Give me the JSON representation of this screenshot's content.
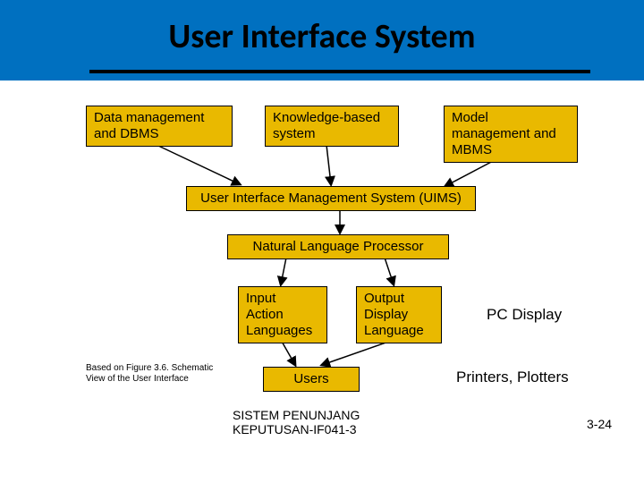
{
  "title": "User Interface System",
  "boxes": {
    "data_mgmt": "Data management and DBMS",
    "knowledge": "Knowledge-based system",
    "model_mgmt": "Model management and MBMS",
    "uims": "User Interface Management System (UIMS)",
    "nlp": "Natural Language Processor",
    "input_l1": "Input",
    "input_l2": "Action Languages",
    "output_l1": "Output",
    "output_l2": "Display Language",
    "users": "Users"
  },
  "labels": {
    "pc_display": "PC Display",
    "printers": "Printers, Plotters"
  },
  "caption": "Based on Figure 3.6. Schematic View of the User Interface",
  "footer": "SISTEM PENUNJANG KEPUTUSAN-IF041-3",
  "page_number": "3-24"
}
